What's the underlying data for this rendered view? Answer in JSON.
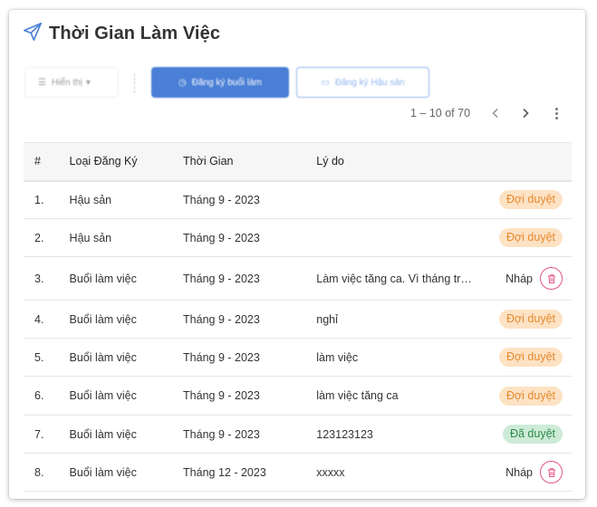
{
  "header": {
    "title": "Thời Gian Làm Việc",
    "icon": "send-icon",
    "accent": "#4a7fd6"
  },
  "toolbar": {
    "sort_label": "Hiển thị",
    "register_label": "Đăng ký buổi làm",
    "register_leave_label": "Đăng ký Hậu sản"
  },
  "pagination": {
    "range": "1 – 10 of 70"
  },
  "table": {
    "columns": [
      "#",
      "Loại Đăng Ký",
      "Thời Gian",
      "Lý do"
    ],
    "rows": [
      {
        "num": "1.",
        "type": "Hậu sản",
        "time": "Tháng 9 - 2023",
        "reason": "",
        "status": "Đợi duyệt",
        "kind": "wait"
      },
      {
        "num": "2.",
        "type": "Hậu sản",
        "time": "Tháng 9 - 2023",
        "reason": "",
        "status": "Đợi duyệt",
        "kind": "wait"
      },
      {
        "num": "3.",
        "type": "Buổi làm việc",
        "time": "Tháng 9 - 2023",
        "reason": "Làm việc tăng ca. Vì tháng trước",
        "status": "Nháp",
        "kind": "draft"
      },
      {
        "num": "4.",
        "type": "Buổi làm việc",
        "time": "Tháng 9 - 2023",
        "reason": "nghỉ",
        "status": "Đợi duyệt",
        "kind": "wait"
      },
      {
        "num": "5.",
        "type": "Buổi làm việc",
        "time": "Tháng 9 - 2023",
        "reason": "làm việc",
        "status": "Đợi duyệt",
        "kind": "wait"
      },
      {
        "num": "6.",
        "type": "Buổi làm việc",
        "time": "Tháng 9 - 2023",
        "reason": "làm việc tăng ca",
        "status": "Đợi duyệt",
        "kind": "wait"
      },
      {
        "num": "7.",
        "type": "Buổi làm việc",
        "time": "Tháng 9 - 2023",
        "reason": "123123123",
        "status": "Đã duyệt",
        "kind": "ok"
      },
      {
        "num": "8.",
        "type": "Buổi làm việc",
        "time": "Tháng 12 - 2023",
        "reason": "xxxxx",
        "status": "Nháp",
        "kind": "draft"
      }
    ]
  },
  "colors": {
    "pending_bg": "#fde2c4",
    "pending_text": "#e8892e",
    "approved_bg": "#cdebd6",
    "approved_text": "#2e8b4e",
    "delete": "#e65588"
  }
}
